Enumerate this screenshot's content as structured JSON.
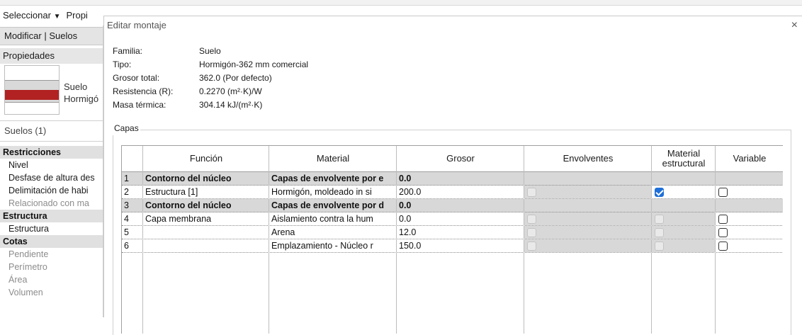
{
  "ribbon": {
    "select_label": "Seleccionar",
    "properties_label": "Propi"
  },
  "left_panel": {
    "context_tab": "Modificar | Suelos",
    "properties_title": "Propiedades",
    "type_family": "Suelo",
    "type_name": "Hormigó",
    "instance_filter": "Suelos (1)",
    "rows": [
      {
        "label": "Restricciones",
        "kind": "group"
      },
      {
        "label": "Nivel",
        "kind": "item"
      },
      {
        "label": "Desfase de altura des",
        "kind": "item"
      },
      {
        "label": "Delimitación de habi",
        "kind": "item"
      },
      {
        "label": "Relacionado con ma",
        "kind": "dim"
      },
      {
        "label": "Estructura",
        "kind": "group"
      },
      {
        "label": "Estructura",
        "kind": "item"
      },
      {
        "label": "Cotas",
        "kind": "group"
      },
      {
        "label": "Pendiente",
        "kind": "dim"
      },
      {
        "label": "Perímetro",
        "kind": "dim"
      },
      {
        "label": "Área",
        "kind": "dim"
      },
      {
        "label": "Volumen",
        "kind": "dim"
      }
    ]
  },
  "dialog": {
    "title": "Editar montaje",
    "close_glyph": "×",
    "info": [
      {
        "label": "Familia:",
        "value": "Suelo"
      },
      {
        "label": "Tipo:",
        "value": "Hormigón-362 mm comercial"
      },
      {
        "label": "Grosor total:",
        "value": "362.0 (Por defecto)"
      },
      {
        "label": "Resistencia (R):",
        "value": "0.2270 (m²·K)/W"
      },
      {
        "label": "Masa térmica:",
        "value": "304.14 kJ/(m²·K)"
      }
    ],
    "layers_label": "Capas",
    "columns": {
      "funcion": "Función",
      "material": "Material",
      "grosor": "Grosor",
      "envolventes": "Envolventes",
      "material_estructural": "Material estructural",
      "variable": "Variable"
    },
    "rows": [
      {
        "num": "1",
        "funcion": "Contorno del núcleo",
        "material": "Capas de envolvente por e",
        "grosor": "0.0",
        "core": true
      },
      {
        "num": "2",
        "funcion": "Estructura [1]",
        "material": "Hormigón, moldeado in si",
        "grosor": "200.0",
        "core": false,
        "estructural_checked": true
      },
      {
        "num": "3",
        "funcion": "Contorno del núcleo",
        "material": "Capas de envolvente por d",
        "grosor": "0.0",
        "core": true
      },
      {
        "num": "4",
        "funcion": "Capa membrana",
        "material": "Aislamiento contra la hum",
        "grosor": "0.0",
        "core": false,
        "estructural_checked": false
      },
      {
        "num": "5",
        "funcion": "",
        "material": "Arena",
        "grosor": "12.0",
        "core": false,
        "estructural_checked": false
      },
      {
        "num": "6",
        "funcion": "",
        "material": "Emplazamiento - Núcleo r",
        "grosor": "150.0",
        "core": false,
        "estructural_checked": false
      }
    ]
  },
  "icons": {
    "dropdown": "caret-down-icon",
    "close": "close-icon"
  }
}
